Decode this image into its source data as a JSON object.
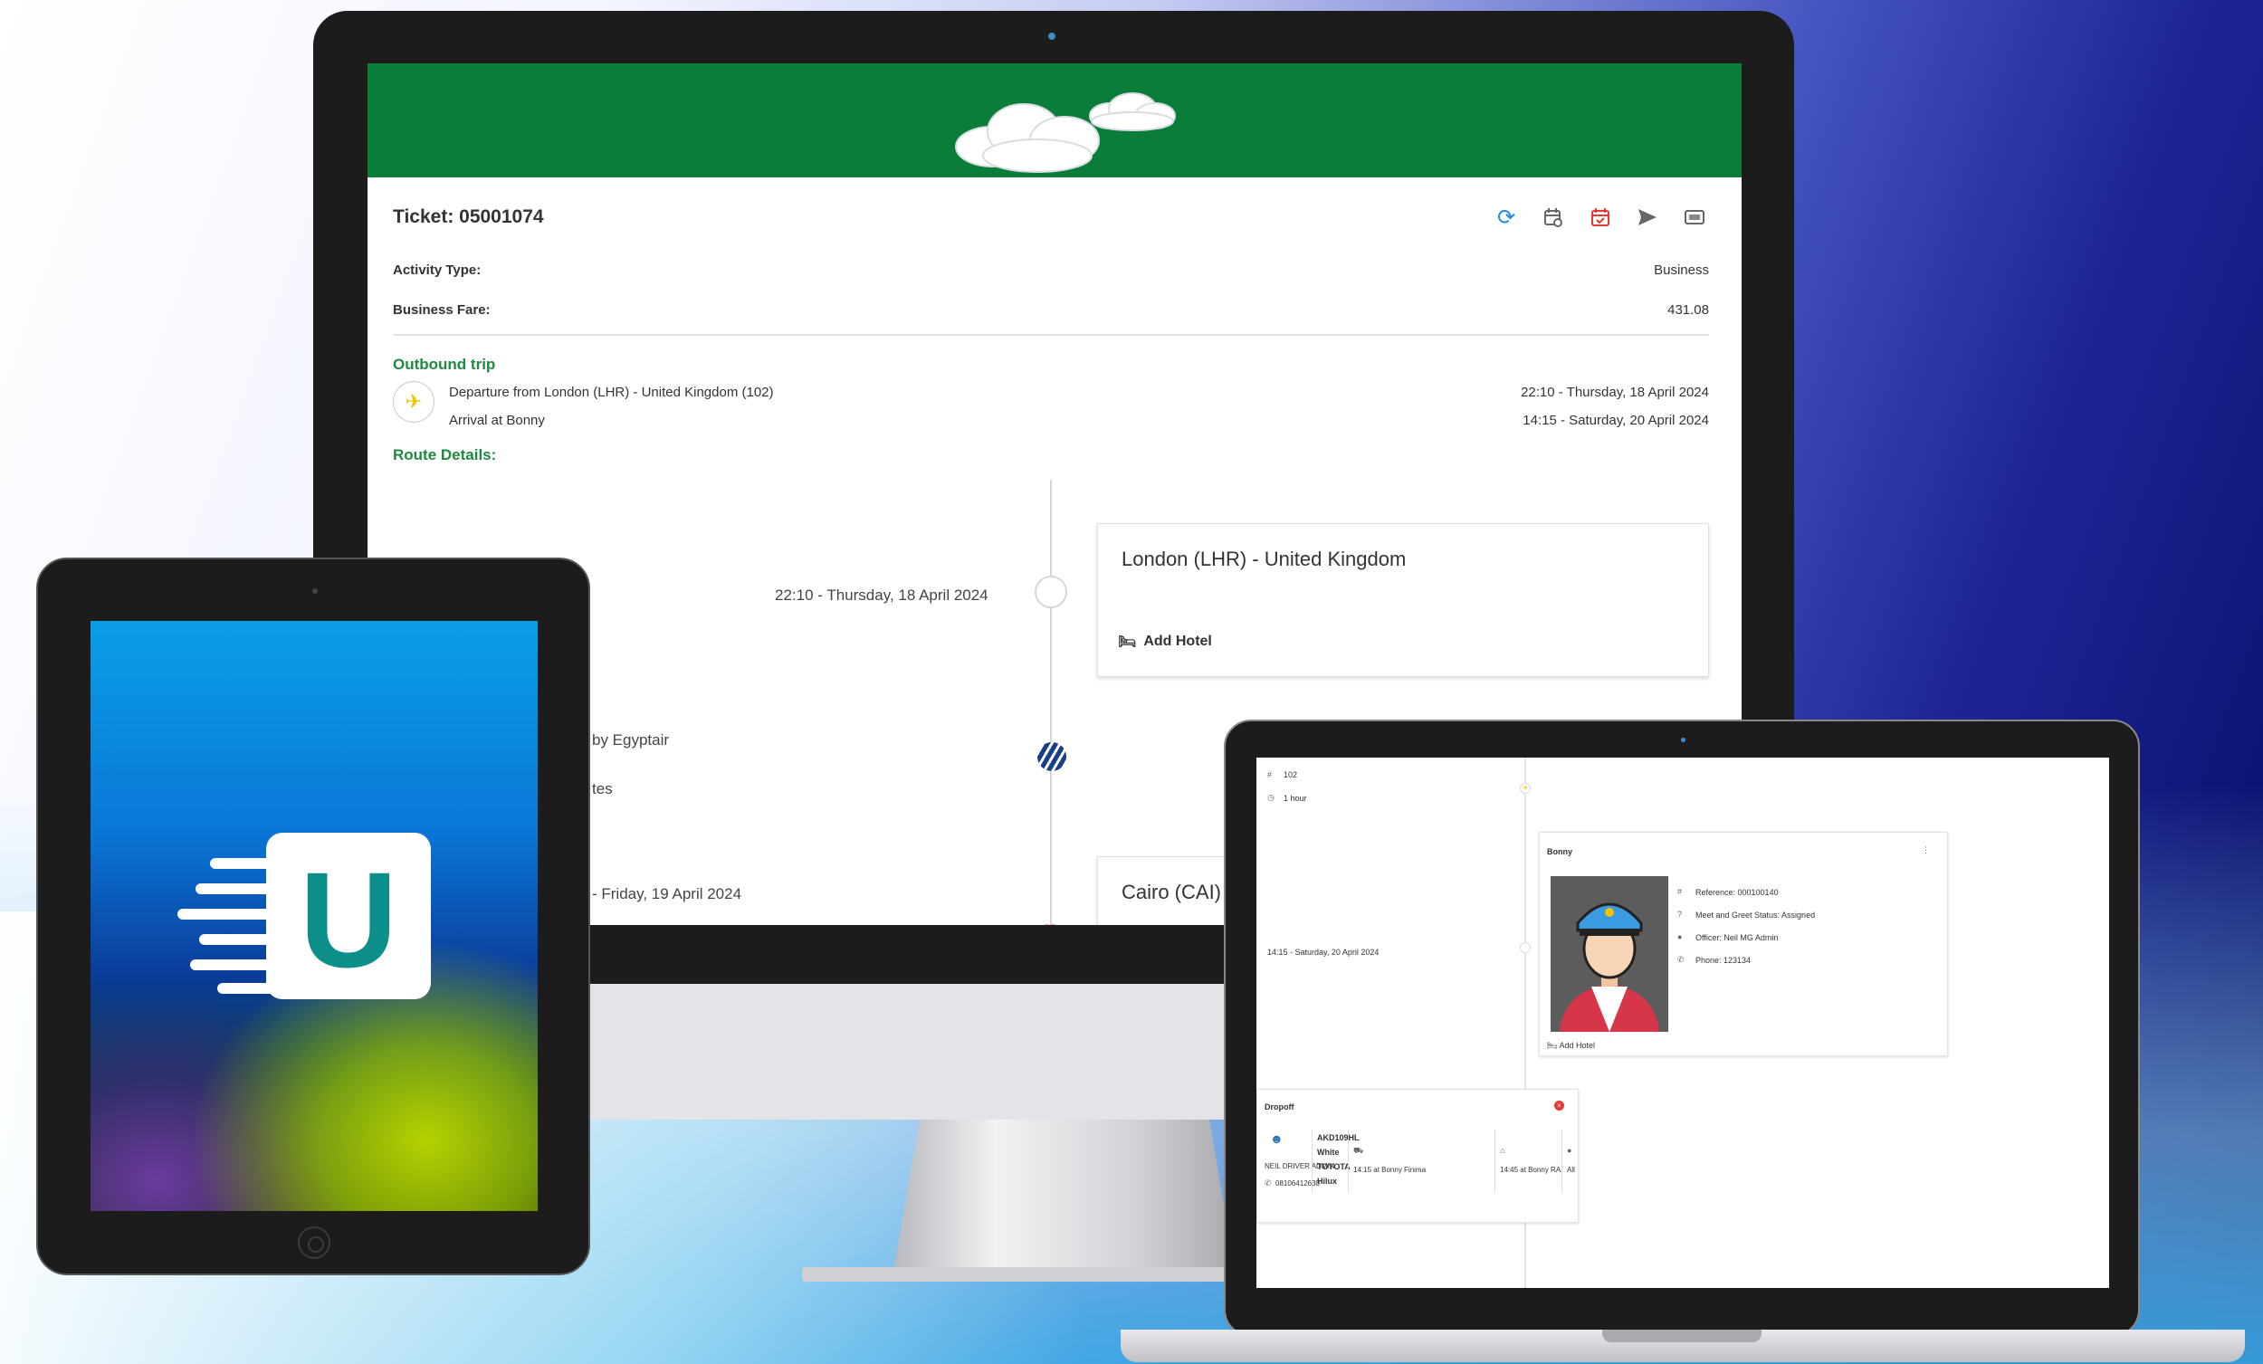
{
  "monitor": {
    "ticket_title": "Ticket: 05001074",
    "activity_type_label": "Activity Type:",
    "activity_type_value": "Business",
    "fare_label": "Business Fare:",
    "fare_value": "431.08",
    "outbound_heading": "Outbound trip",
    "departure": "Departure from London (LHR) - United Kingdom (102)",
    "departure_time": "22:10 - Thursday, 18 April 2024",
    "arrival": "Arrival at Bonny",
    "arrival_time": "14:15 - Saturday, 20 April 2024",
    "route_heading": "Route Details:",
    "stop1_time": "22:10 - Thursday, 18 April 2024",
    "stop1_title": "London (LHR) - United Kingdom",
    "add_hotel": "Add Hotel",
    "airline_text": "by Egyptair",
    "minutes_text": "tes",
    "stop2_time": "- Friday, 19 April 2024",
    "stop2_title": "Cairo (CAI)",
    "icons": [
      "refresh-icon",
      "calendar-add-icon",
      "calendar-check-icon",
      "send-icon",
      "ticket-icon"
    ]
  },
  "tablet": {
    "logo_letter": "U"
  },
  "laptop": {
    "flight_number": "102",
    "duration": "1 hour",
    "arrival_time": "14:15 - Saturday, 20 April 2024",
    "officer_card": {
      "title": "Bonny",
      "reference": "Reference: 000100140",
      "status": "Meet and Greet Status: Assigned",
      "officer": "Officer: Neil MG Admin",
      "phone": "Phone: 123134",
      "add_hotel": "Add Hotel"
    },
    "dropoff": {
      "title": "Dropoff",
      "driver": "NEIL DRIVER ADMIN",
      "driver_phone": "08106412630",
      "plate": "AKD109HL",
      "color": "White",
      "make": "TOYOTA",
      "model": "Hilux",
      "pickup": "14:15 at Bonny Finima",
      "drop": "14:45 at Bonny RA",
      "passengers": "All"
    }
  },
  "colors": {
    "banner_green": "#0b7d3b",
    "heading_green": "#1d8a3e",
    "accent_blue": "#1f8be0",
    "accent_red": "#e53935"
  }
}
